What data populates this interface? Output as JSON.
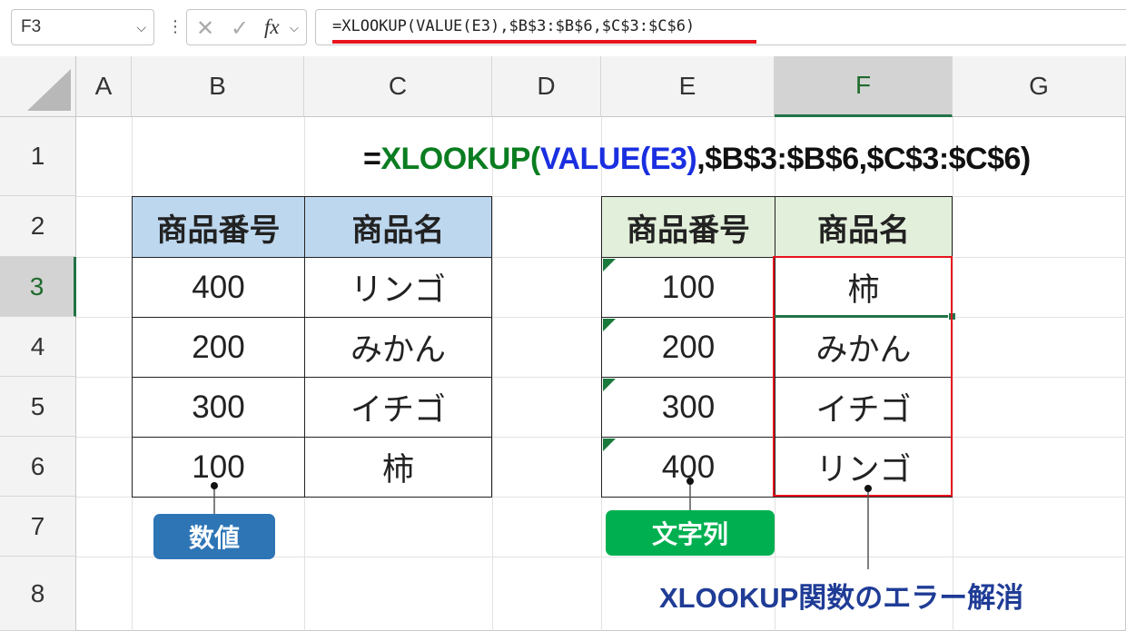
{
  "formula_bar": {
    "name_box": "F3",
    "formula": "=XLOOKUP(VALUE(E3),$B$3:$B$6,$C$3:$C$6)",
    "fx_label": "fx"
  },
  "columns": [
    "A",
    "B",
    "C",
    "D",
    "E",
    "F",
    "G"
  ],
  "rows": [
    "1",
    "2",
    "3",
    "4",
    "5",
    "6",
    "7",
    "8"
  ],
  "big_formula": {
    "eq": "=",
    "fn": "XLOOKUP",
    "open": "(",
    "inner": "VALUE(E3)",
    "rest": ",$B$3:$B$6,$C$3:$C$6)"
  },
  "left_table": {
    "headers": [
      "商品番号",
      "商品名"
    ],
    "rows": [
      [
        "400",
        "リンゴ"
      ],
      [
        "200",
        "みかん"
      ],
      [
        "300",
        "イチゴ"
      ],
      [
        "100",
        "柿"
      ]
    ]
  },
  "right_table": {
    "headers": [
      "商品番号",
      "商品名"
    ],
    "rows": [
      [
        "100",
        "柿"
      ],
      [
        "200",
        "みかん"
      ],
      [
        "300",
        "イチゴ"
      ],
      [
        "400",
        "リンゴ"
      ]
    ]
  },
  "labels": {
    "number_badge": "数値",
    "text_badge": "文字列",
    "caption_main": "XLOOKUP関数の",
    "caption_accent": "エラー解消"
  },
  "colors": {
    "left_header_bg": "#bdd7ee",
    "right_header_bg": "#e2efda",
    "number_badge": "#2e75b6",
    "text_badge": "#00b050",
    "highlight_border": "#e8131d",
    "caption": "#1f3c96"
  }
}
